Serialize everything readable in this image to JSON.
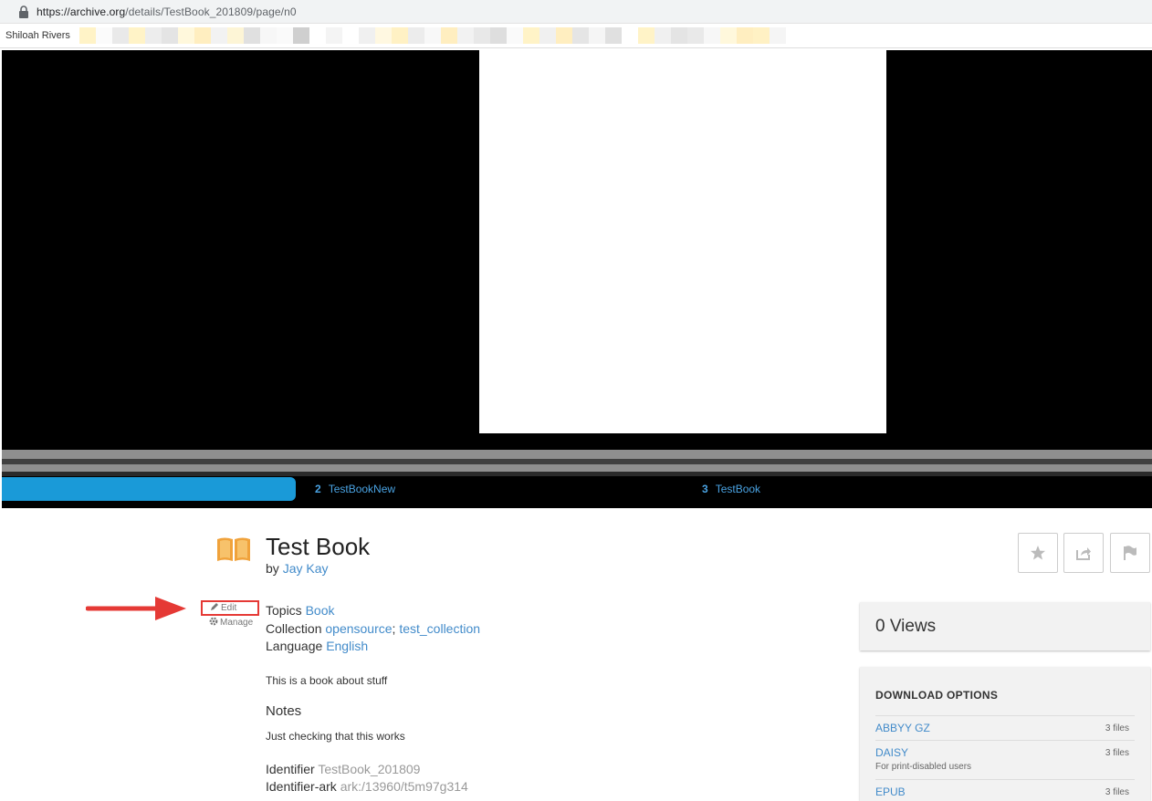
{
  "browser": {
    "url_domain": "https://archive.org",
    "url_path": "/details/TestBook_201809/page/n0",
    "bookmark_user": "Shiloah Rivers"
  },
  "reader": {
    "chapters": [
      {
        "number": "2",
        "title": "TestBookNew"
      },
      {
        "number": "3",
        "title": "TestBook"
      }
    ]
  },
  "item": {
    "title": "Test Book",
    "by_label": "by",
    "author": "Jay Kay",
    "edit_label": "Edit",
    "manage_label": "Manage",
    "topics_label": "Topics",
    "topics_value": "Book",
    "collection_label": "Collection",
    "collection_values": [
      "opensource",
      "test_collection"
    ],
    "language_label": "Language",
    "language_value": "English",
    "description": "This is a book about stuff",
    "notes_heading": "Notes",
    "notes_body": "Just checking that this works",
    "identifier_label": "Identifier",
    "identifier_value": "TestBook_201809",
    "identifier_ark_label": "Identifier-ark",
    "identifier_ark_value": "ark:/13960/t5m97g314"
  },
  "sidebar": {
    "views": "0 Views",
    "download_heading": "DOWNLOAD OPTIONS",
    "downloads": [
      {
        "name": "ABBYY GZ",
        "count": "3 files",
        "sub": ""
      },
      {
        "name": "DAISY",
        "count": "3 files",
        "sub": "For print-disabled users"
      },
      {
        "name": "EPUB",
        "count": "3 files",
        "sub": ""
      }
    ]
  },
  "colors": {
    "accent": "#428bca",
    "chapter_progress": "#1a9ad8",
    "annotation_red": "#e53935",
    "book_icon": "#f0a23b"
  },
  "icons": [
    "lock-icon",
    "book-icon",
    "pencil-icon",
    "gear-icon",
    "star-icon",
    "share-icon",
    "flag-icon",
    "red-arrow-annotation"
  ]
}
